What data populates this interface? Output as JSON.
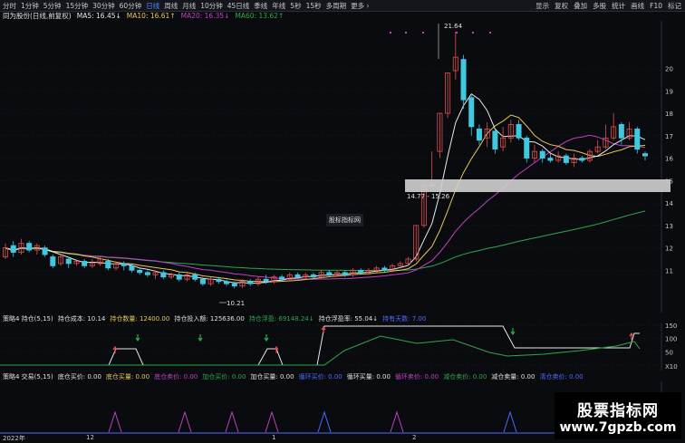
{
  "toolbar": {
    "tabs": [
      "分时",
      "1分钟",
      "5分钟",
      "15分钟",
      "30分钟",
      "60分钟",
      "日线",
      "周线",
      "月线",
      "10分钟",
      "45日线",
      "季线",
      "年线",
      "5秒",
      "15秒",
      "多周期",
      "更多 ›"
    ],
    "active_index": 6,
    "right_items": [
      "显示",
      "复权",
      "叠加",
      "多股",
      "统计",
      "画线",
      "F10",
      "标记"
    ]
  },
  "info": {
    "stock": "同为股份(日线,前复权)",
    "ma5": "MA5: 16.45↓",
    "ma10": "MA10: 16.61↑",
    "ma20": "MA20: 16.35↓",
    "ma60": "MA60: 13.62↑"
  },
  "colors": {
    "ma5": "#e8e8e8",
    "ma10": "#e6c85a",
    "ma20": "#c040c0",
    "ma60": "#2ea84a",
    "up": "#e05050",
    "down": "#40c8e0",
    "accent": "#4a8cff"
  },
  "price_axis": [
    "20",
    "19",
    "18",
    "17",
    "16",
    "15",
    "14",
    "13",
    "12",
    "11"
  ],
  "annotations": {
    "high": "21.64",
    "low": "10.21",
    "band": "14.77 - 15.26"
  },
  "popup_label": "股标指标网",
  "indicator1": {
    "name": "策略4 持仓(5,15)",
    "cost": "持仓成本: 10.14",
    "qty": "持仓数量: 12400.00",
    "invest": "持仓投入额: 125636.00",
    "float_amt": "持仓浮盈: 69148.24↓",
    "float_rate": "持仓浮盈率: 55.04↓",
    "extra": "持有天数: 7.00",
    "axis": [
      "150",
      "100",
      "50",
      "X10"
    ]
  },
  "indicator2": {
    "name": "策略4 交易(5,15)",
    "items": [
      "底仓买价: 0.00",
      "底仓买量: 0.00",
      "底仓卖价: 0.00",
      "加仓买价: 0.00",
      "加仓买量: 0.00",
      "循环买价: 0.00",
      "循环买量: 0.00",
      "循环卖价: 0.00",
      "减仓卖价: 0.00",
      "减仓卖量: 0.00",
      "清仓卖价: 0.00"
    ]
  },
  "date_axis": [
    "2022年",
    "12",
    "1",
    "2"
  ],
  "watermark": {
    "line1": "股票指标网",
    "line2": "www.7gpzb.com"
  }
}
